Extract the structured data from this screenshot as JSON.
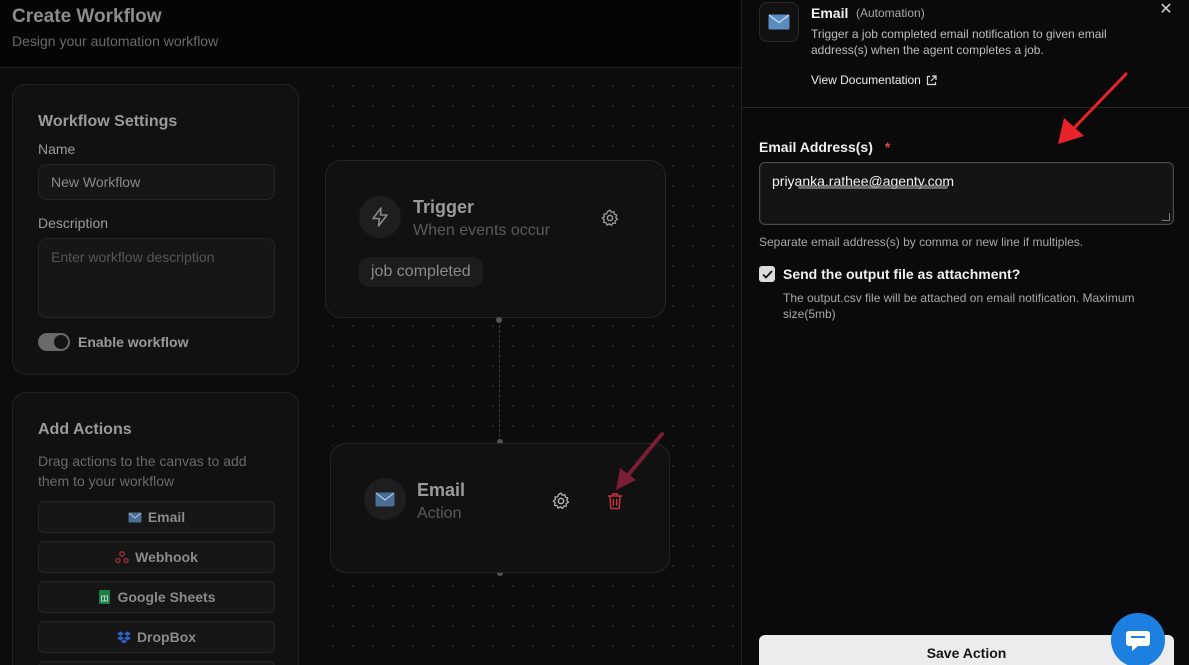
{
  "header": {
    "title": "Create Workflow",
    "subtitle": "Design your automation workflow"
  },
  "settings": {
    "title": "Workflow Settings",
    "name_label": "Name",
    "name_value": "New Workflow",
    "description_label": "Description",
    "description_placeholder": "Enter workflow description",
    "enable_label": "Enable workflow",
    "enabled": true
  },
  "actions": {
    "title": "Add Actions",
    "hint": "Drag actions to the canvas to add them to your workflow",
    "items": [
      {
        "label": "Email",
        "icon": "envelope-icon"
      },
      {
        "label": "Webhook",
        "icon": "webhook-icon"
      },
      {
        "label": "Google Sheets",
        "icon": "google-sheets-icon"
      },
      {
        "label": "DropBox",
        "icon": "dropbox-icon"
      }
    ]
  },
  "canvas": {
    "trigger": {
      "title": "Trigger",
      "subtitle": "When events occur",
      "event": "job completed"
    },
    "action": {
      "title": "Email",
      "subtitle": "Action"
    }
  },
  "panel": {
    "name": "Email",
    "tag": "(Automation)",
    "description": "Trigger a job completed email notification to given email address(s) when the agent completes a job.",
    "doc_link": "View Documentation",
    "email_label": "Email Address(s)",
    "required_mark": "*",
    "email_value": "priyanka.rathee@agenty.com",
    "email_hint": "Separate email address(s) by comma or new line if multiples.",
    "attach_label": "Send the output file as attachment?",
    "attach_checked": true,
    "attach_hint": "The output.csv file will be attached on email notification. Maximum size(5mb)",
    "save_label": "Save Action"
  },
  "colors": {
    "accent_red": "#e0464e",
    "chat_blue": "#1d7fe0",
    "annotation_red": "#e8242a",
    "annotation_dark": "#7a1e35"
  }
}
